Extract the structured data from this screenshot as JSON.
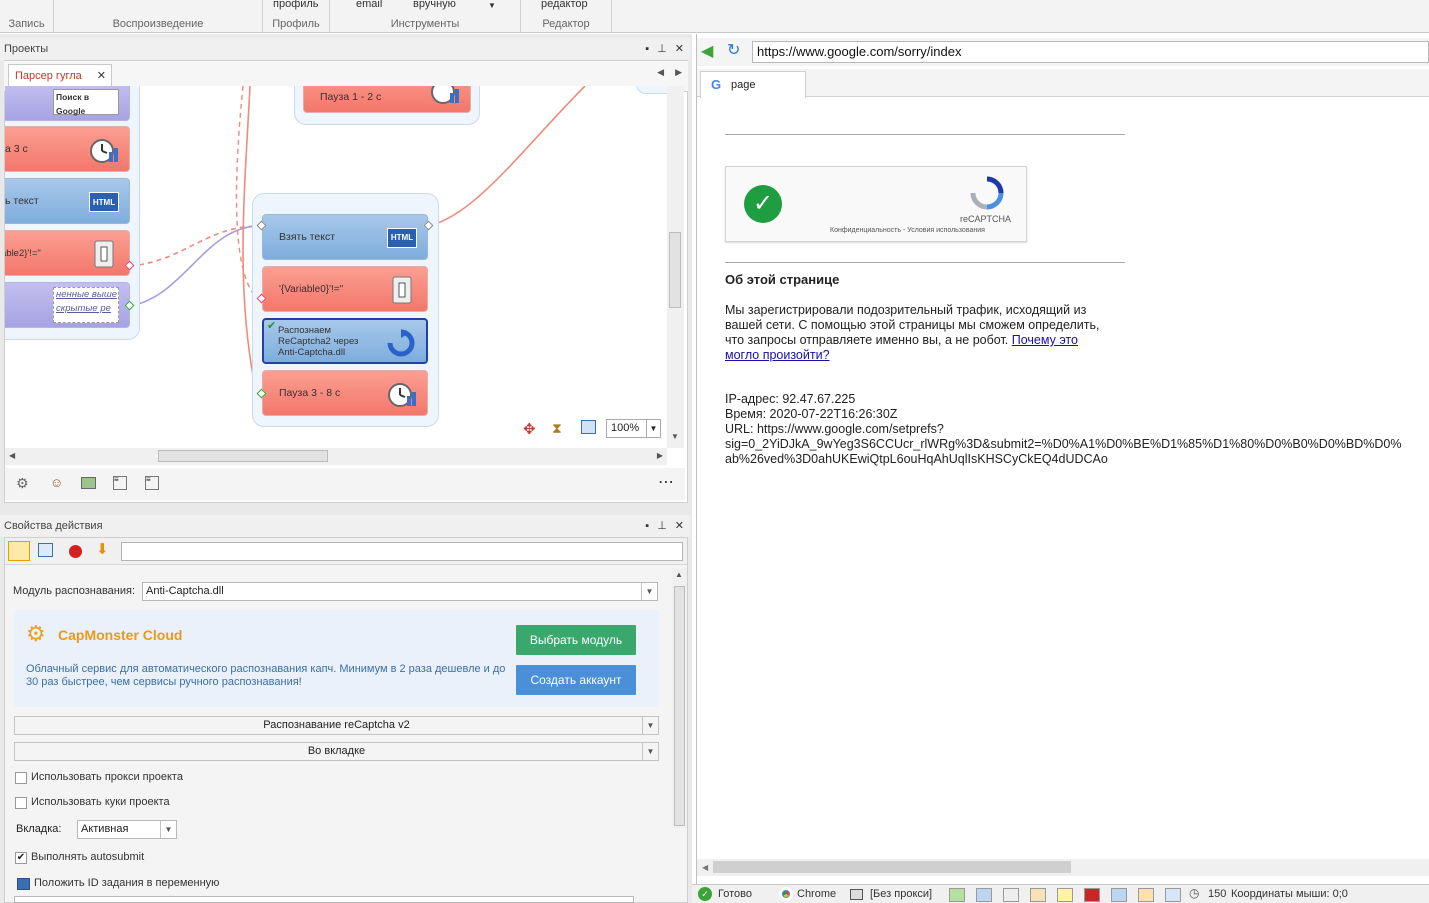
{
  "ribbon": {
    "groups": [
      {
        "caption": "Запись",
        "top": ""
      },
      {
        "caption": "Воспроизведение",
        "top": ""
      },
      {
        "caption": "Профиль",
        "top": "профиль"
      },
      {
        "caption": "Инструменты",
        "top": "email",
        "top2": "вручную"
      },
      {
        "caption": "Редактор",
        "top": "редактор"
      }
    ]
  },
  "projects": {
    "title": "Проекты",
    "tab": "Парсер гугла",
    "zoom": "100%",
    "nodes": {
      "search_google": "Поиск в Google",
      "pause_3": "а 3 с",
      "get_text_left": "ь текст",
      "variable2": "able2}'!=\"",
      "hidden1": "ненные выше",
      "hidden2": "скрытые ре",
      "pause_1_2": "Пауза 1 - 2 с",
      "get_text": "Взять текст",
      "variable0": "'{Variable0}'!=\"",
      "recaptcha": "Распознаем ReCaptcha2 через Anti-Captcha.dll",
      "pause_3_8": "Пауза 3 - 8 с"
    },
    "icon_html": "HTML"
  },
  "props": {
    "title": "Свойства действия",
    "module_label": "Модуль распознавания:",
    "module_value": "Anti-Captcha.dll",
    "capmonster_title": "CapMonster Cloud",
    "capmonster_desc": "Облачный сервис для автоматического распознавания капч. Минимум в 2 раза дешевле и до 30 раз быстрее, чем сервисы ручного распознавания!",
    "btn_select": "Выбрать модуль",
    "btn_create": "Создать аккаунт",
    "dd_recaptcha": "Распознавание reCaptcha v2",
    "dd_tab": "Во вкладке",
    "use_proxy": "Использовать прокси проекта",
    "use_cookies": "Использовать куки проекта",
    "tab_label": "Вкладка:",
    "tab_value": "Активная",
    "autosubmit": "Выполнять autosubmit",
    "task_id": "Положить ID задания в переменную"
  },
  "browser": {
    "url": "https://www.google.com/sorry/index",
    "tab": "page",
    "recaptcha_label": "reCAPTCHA",
    "recaptcha_links": "Конфиденциальность - Условия использования",
    "about_title": "Об этой странице",
    "about_text1": "Мы зарегистрировали подозрительный трафик, исходящий из",
    "about_text2": "вашей сети. С помощью этой страницы мы сможем определить,",
    "about_text3": "что запросы отправляете именно вы, а не робот.",
    "about_link1": "Почему это",
    "about_link2": "могло произойти?",
    "ip": "IP-адрес: 92.47.67.225",
    "time": "Время: 2020-07-22T16:26:30Z",
    "url_line1": "URL: https://www.google.com/setprefs?",
    "url_line2": "sig=0_2YiDJkA_9wYeg3S6CCUcr_rlWRg%3D&submit2=%D0%A1%D0%BE%D1%85%D1%80%D0%B0%D0%BD%D0%",
    "url_line3": "ab%26ved%3D0ahUKEwiQtpL6ouHqAhUqlIsKHSCyCkEQ4dUDCAo"
  },
  "status": {
    "ready": "Готово",
    "browser": "Chrome",
    "proxy": "[Без прокси]",
    "threads": "150",
    "coords": "Координаты мыши: 0;0"
  },
  "colors": {
    "accent_green": "#3aa76d",
    "accent_blue": "#4a8fd8",
    "node_red": "#f3776a",
    "node_blue": "#7eaddc"
  }
}
